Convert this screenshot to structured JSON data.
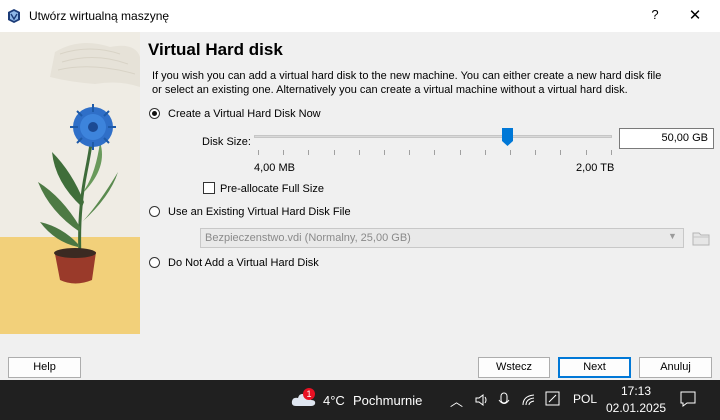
{
  "window": {
    "title": "Utwórz wirtualną maszynę",
    "help_glyph": "?",
    "close_glyph": "✕"
  },
  "page": {
    "heading": "Virtual Hard disk",
    "description": "If you wish you can add a virtual hard disk to the new machine. You can either create a new hard disk file or select an existing one. Alternatively you can create a virtual machine without a virtual hard disk."
  },
  "options": {
    "create_now": {
      "label": "Create a Virtual Hard Disk Now",
      "selected": true
    },
    "use_existing": {
      "label": "Use an Existing Virtual Hard Disk File",
      "selected": false
    },
    "no_disk": {
      "label": "Do Not Add a Virtual Hard Disk",
      "selected": false
    }
  },
  "disk": {
    "size_label": "Disk Size:",
    "size_value": "50,00 GB",
    "min_label": "4,00 MB",
    "max_label": "2,00 TB",
    "preallocate_label": "Pre-allocate Full Size",
    "preallocate_checked": false,
    "existing_file": "Bezpieczenstwo.vdi (Normalny, 25,00 GB)"
  },
  "buttons": {
    "help": "Help",
    "back": "Wstecz",
    "next": "Next",
    "cancel": "Anuluj"
  },
  "taskbar": {
    "weather_badge": "1",
    "temperature": "4°C",
    "weather_text": "Pochmurnie",
    "language": "POL",
    "time": "17:13",
    "date": "02.01.2025"
  },
  "colors": {
    "accent": "#0078d7",
    "slider_thumb": "#0078d7",
    "taskbar": "#202020"
  }
}
